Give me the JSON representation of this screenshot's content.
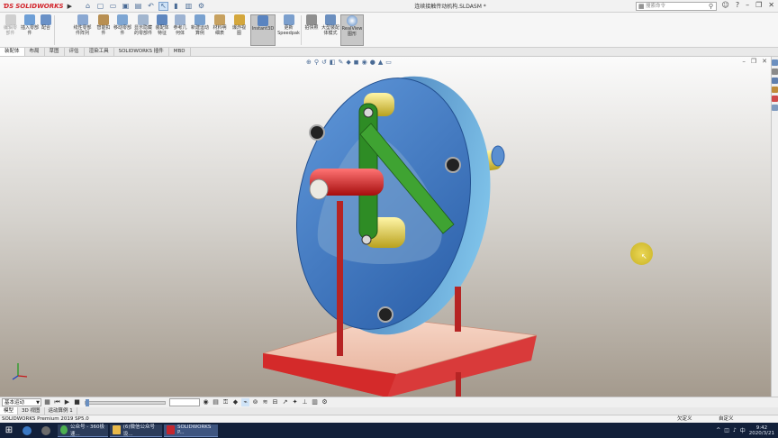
{
  "app": {
    "brand": "SOLIDWORKS",
    "document_title": "连续接触传动机构.SLDASM *",
    "search_placeholder": "搜索命令"
  },
  "ribbon": {
    "buttons": [
      {
        "id": "edit-component",
        "label": "编辑零部件",
        "disabled": true
      },
      {
        "id": "insert-component",
        "label": "插入零部件"
      },
      {
        "id": "mate",
        "label": "配合"
      },
      {
        "id": "linear-pattern",
        "label": "线性零部件阵列"
      },
      {
        "id": "smart-fasteners",
        "label": "智能扣件"
      },
      {
        "id": "move-component",
        "label": "移动零部件"
      },
      {
        "id": "show-hidden",
        "label": "显示隐藏的零部件"
      },
      {
        "id": "assembly-features",
        "label": "装配体特征"
      },
      {
        "id": "reference-geometry",
        "label": "参考几何体"
      },
      {
        "id": "new-motion-study",
        "label": "新建运动算例"
      },
      {
        "id": "bom",
        "label": "材料明细表"
      },
      {
        "id": "exploded-view",
        "label": "爆炸视图"
      },
      {
        "id": "instant3d",
        "label": "Instant3D",
        "active": true
      },
      {
        "id": "update-speedpak",
        "label": "更新Speedpak"
      },
      {
        "id": "snapshot",
        "label": "拍快照"
      },
      {
        "id": "large-assembly",
        "label": "大型装配体模式"
      },
      {
        "id": "realview",
        "label": "RealView图形",
        "active": true
      }
    ]
  },
  "command_tabs": [
    "装配体",
    "布局",
    "草图",
    "评估",
    "渲染工具",
    "SOLIDWORKS 插件",
    "MBD"
  ],
  "active_tab": 0,
  "motion": {
    "study_type": "基本运动",
    "time_value": ""
  },
  "bottom_tabs": [
    "模型",
    "3D 视图",
    "运动算例 1"
  ],
  "active_bottom_tab": 0,
  "status": {
    "left": "SOLIDWORKS Premium 2019 SP5.0",
    "state": "欠定义",
    "edit_mode": "在编辑 装配体",
    "custom": "自定义"
  },
  "taskbar": {
    "apps": [
      {
        "label": "公众号 - 360极速..."
      },
      {
        "label": "(6)微信公众号设..."
      },
      {
        "label": "SOLIDWORKS P..."
      }
    ],
    "time": "9:42",
    "date": "2020/3/21"
  }
}
